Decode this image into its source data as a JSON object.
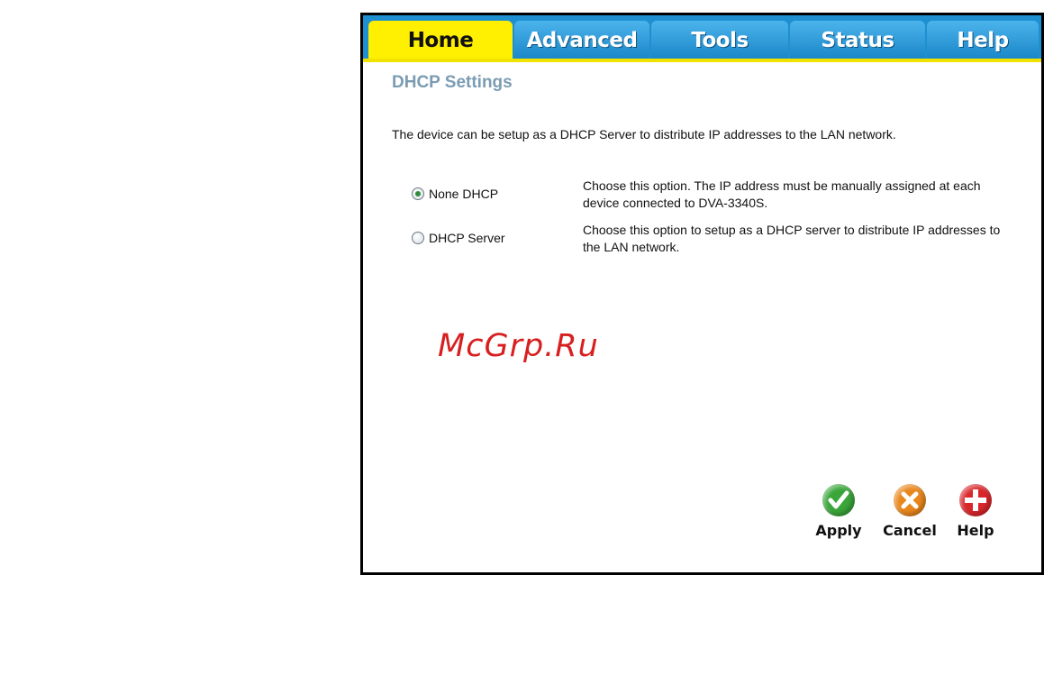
{
  "tabs": [
    {
      "label": "Home",
      "active": true
    },
    {
      "label": "Advanced",
      "active": false
    },
    {
      "label": "Tools",
      "active": false
    },
    {
      "label": "Status",
      "active": false
    },
    {
      "label": "Help",
      "active": false
    }
  ],
  "page": {
    "heading": "DHCP Settings",
    "intro": "The device can be setup as a DHCP Server to distribute IP addresses to the LAN network."
  },
  "options": [
    {
      "label": "None DHCP",
      "selected": true,
      "description": "Choose this option. The IP address must be manually assigned at each device connected to DVA-3340S."
    },
    {
      "label": "DHCP Server",
      "selected": false,
      "description": "Choose this option to setup as a DHCP server to distribute IP addresses to the LAN network."
    }
  ],
  "watermark": "McGrp.Ru",
  "actions": {
    "apply": {
      "label": "Apply",
      "icon": "check-icon",
      "color": "#3aa63a"
    },
    "cancel": {
      "label": "Cancel",
      "icon": "x-icon",
      "color": "#e9871d"
    },
    "help": {
      "label": "Help",
      "icon": "plus-icon",
      "color": "#d9262a"
    }
  },
  "colors": {
    "tab_active": "#ffef00",
    "tab_bar": "#1e8fd0",
    "heading": "#7b9cb3",
    "watermark": "#d81f1f"
  }
}
